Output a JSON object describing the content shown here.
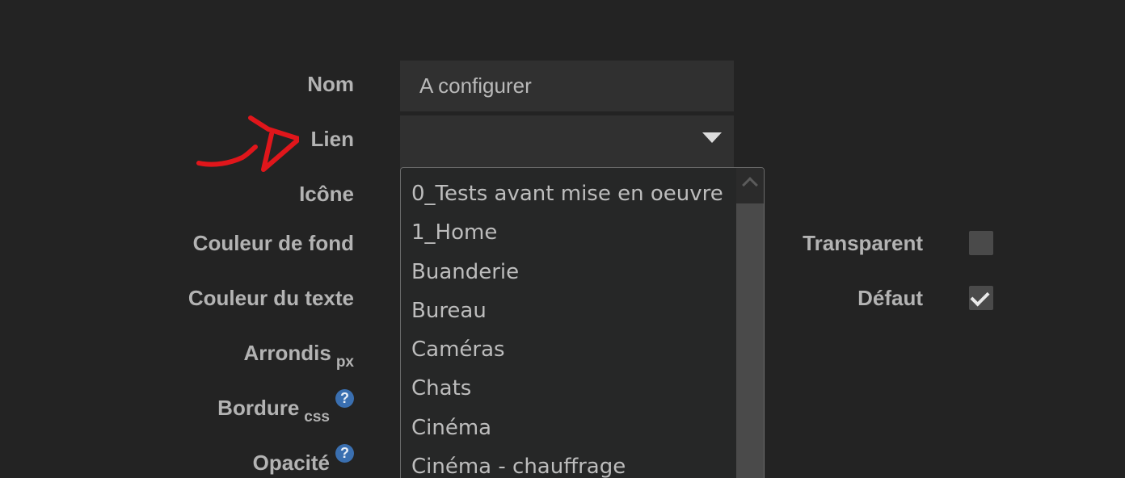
{
  "form": {
    "labels": {
      "name": "Nom",
      "link": "Lien",
      "icon": "Icône",
      "background_color": "Couleur de fond",
      "text_color": "Couleur du texte",
      "rounding": "Arrondis",
      "rounding_unit": "px",
      "border": "Bordure",
      "border_unit": "css",
      "opacity": "Opacité"
    },
    "name_value": "A configurer",
    "help_glyph": "?"
  },
  "right_options": {
    "transparent_label": "Transparent",
    "transparent_checked": false,
    "default_label": "Défaut",
    "default_checked": true
  },
  "dropdown": {
    "items": [
      "0_Tests avant mise en oeuvre",
      "1_Home",
      "Buanderie",
      "Bureau",
      "Caméras",
      "Chats",
      "Cinéma",
      "Cinéma - chauffrage"
    ]
  },
  "colors": {
    "background": "#232323",
    "annotation_red": "#e0161b",
    "help_blue": "#3a6fb0"
  }
}
